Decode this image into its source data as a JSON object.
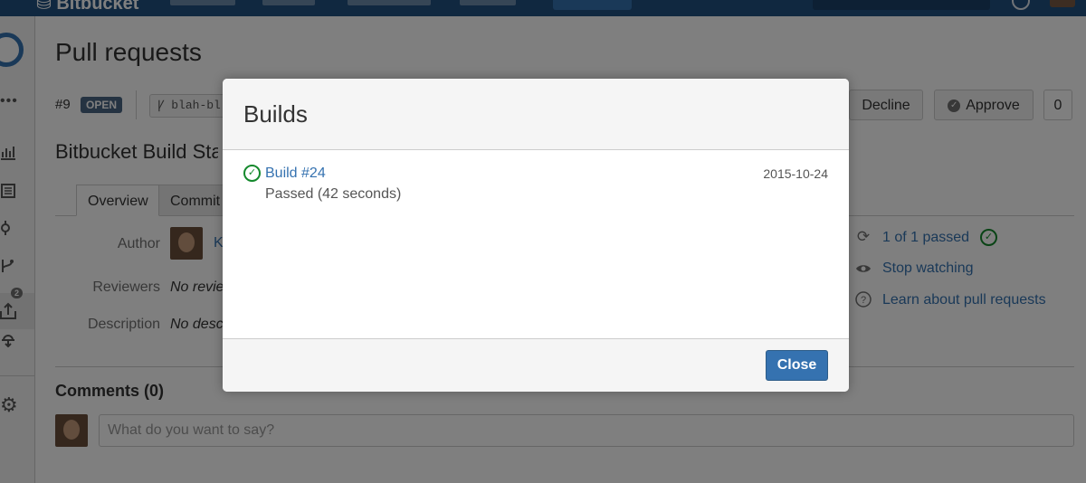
{
  "app": {
    "logo": "Bitbucket"
  },
  "sidebar": {
    "notification_count": "2"
  },
  "page": {
    "title": "Pull requests",
    "pr_number": "#9",
    "status": "OPEN",
    "branch": "blah-bl",
    "pr_title": "Bitbucket Build Sta",
    "tabs": [
      {
        "label": "Overview"
      },
      {
        "label": "Commit"
      }
    ],
    "actions": {
      "decline": "Decline",
      "approve": "Approve",
      "approve_count": "0"
    },
    "meta": {
      "author_label": "Author",
      "author_value": "K",
      "reviewers_label": "Reviewers",
      "reviewers_value": "No revie",
      "description_label": "Description",
      "description_value": "No desc"
    },
    "side_links": {
      "builds": "1 of 1 passed",
      "watch": "Stop watching",
      "learn": "Learn about pull requests"
    },
    "comments": {
      "title": "Comments (0)",
      "placeholder": "What do you want to say?"
    }
  },
  "dialog": {
    "title": "Builds",
    "builds": [
      {
        "name": "Build #24",
        "date": "2015-10-24",
        "status": "Passed (42 seconds)"
      }
    ],
    "close_label": "Close"
  },
  "colors": {
    "primary": "#3572b0",
    "success": "#14892c",
    "header": "#205081"
  }
}
